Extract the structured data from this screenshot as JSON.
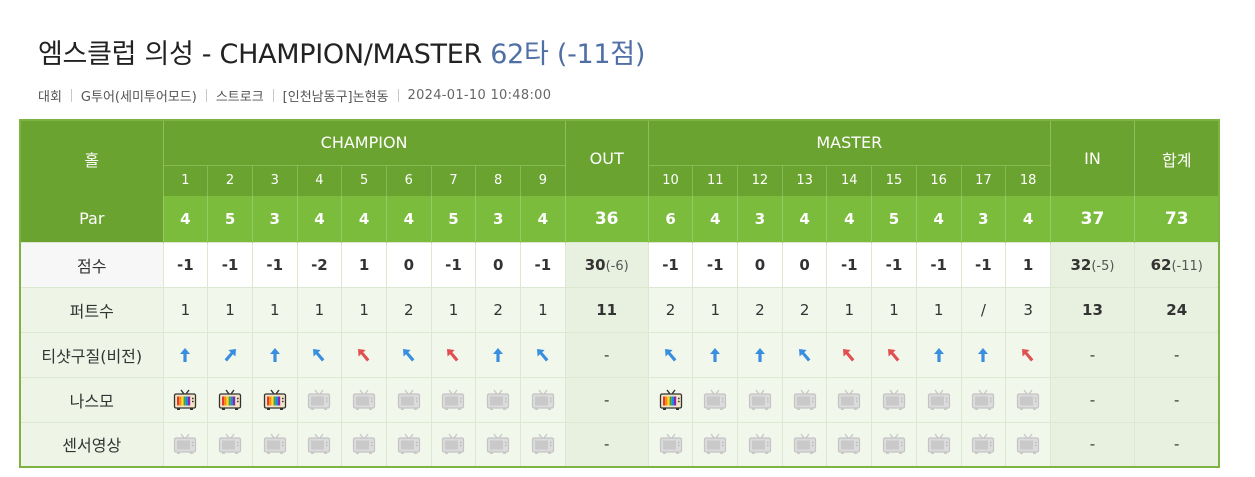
{
  "title": {
    "main": "엠스클럽 의성 - CHAMPION/MASTER",
    "score": "62타 (-11점)"
  },
  "meta": {
    "type": "대회",
    "mode": "G투어(세미투어모드)",
    "play": "스트로크",
    "location": "[인천남동구]논현동",
    "datetime": "2024-01-10 10:48:00"
  },
  "table": {
    "hole_label": "홀",
    "front_course": "CHAMPION",
    "back_course": "MASTER",
    "out_label": "OUT",
    "in_label": "IN",
    "total_label": "합계",
    "front_holes": [
      "1",
      "2",
      "3",
      "4",
      "5",
      "6",
      "7",
      "8",
      "9"
    ],
    "back_holes": [
      "10",
      "11",
      "12",
      "13",
      "14",
      "15",
      "16",
      "17",
      "18"
    ],
    "par": {
      "label": "Par",
      "front": [
        "4",
        "5",
        "3",
        "4",
        "4",
        "4",
        "5",
        "3",
        "4"
      ],
      "out": "36",
      "back": [
        "6",
        "4",
        "3",
        "4",
        "4",
        "5",
        "4",
        "3",
        "4"
      ],
      "in": "37",
      "total": "73"
    },
    "score": {
      "label": "점수",
      "front": [
        "-1",
        "-1",
        "-1",
        "-2",
        "1",
        "0",
        "-1",
        "0",
        "-1"
      ],
      "out": "30",
      "out_diff": "(-6)",
      "back": [
        "-1",
        "-1",
        "0",
        "0",
        "-1",
        "-1",
        "-1",
        "-1",
        "1"
      ],
      "in": "32",
      "in_diff": "(-5)",
      "total": "62",
      "total_diff": "(-11)"
    },
    "putts": {
      "label": "퍼트수",
      "front": [
        "1",
        "1",
        "1",
        "1",
        "1",
        "2",
        "1",
        "2",
        "1"
      ],
      "out": "11",
      "back": [
        "2",
        "1",
        "2",
        "2",
        "1",
        "1",
        "1",
        "/",
        "3"
      ],
      "in": "13",
      "total": "24"
    },
    "tee": {
      "label": "티샷구질(비전)",
      "front": [
        "up-blue",
        "upright-blue",
        "up-blue",
        "upleft-blue",
        "upleft-red",
        "upleft-blue",
        "upleft-red",
        "up-blue",
        "upleft-blue"
      ],
      "out": "-",
      "back": [
        "upleft-blue",
        "up-blue",
        "up-blue",
        "upleft-blue",
        "upleft-red",
        "upleft-red",
        "up-blue",
        "up-blue",
        "upleft-red"
      ],
      "in": "-",
      "total": "-"
    },
    "nasmo": {
      "label": "나스모",
      "front": [
        "tv-color",
        "tv-color",
        "tv-color",
        "tv-gray",
        "tv-gray",
        "tv-gray",
        "tv-gray",
        "tv-gray",
        "tv-gray"
      ],
      "out": "-",
      "back": [
        "tv-color",
        "tv-gray",
        "tv-gray",
        "tv-gray",
        "tv-gray",
        "tv-gray",
        "tv-gray",
        "tv-gray",
        "tv-gray"
      ],
      "in": "-",
      "total": "-"
    },
    "sensor": {
      "label": "센서영상",
      "front": [
        "tv-gray",
        "tv-gray",
        "tv-gray",
        "tv-gray",
        "tv-gray",
        "tv-gray",
        "tv-gray",
        "tv-gray",
        "tv-gray"
      ],
      "out": "-",
      "back": [
        "tv-gray",
        "tv-gray",
        "tv-gray",
        "tv-gray",
        "tv-gray",
        "tv-gray",
        "tv-gray",
        "tv-gray",
        "tv-gray"
      ],
      "in": "-",
      "total": "-"
    }
  },
  "colors": {
    "green_dark": "#6aa330",
    "green_light": "#7cbc3c",
    "arrow_blue": "#3a8ee0",
    "arrow_red": "#e05050",
    "title_score": "#4f6fa5"
  }
}
